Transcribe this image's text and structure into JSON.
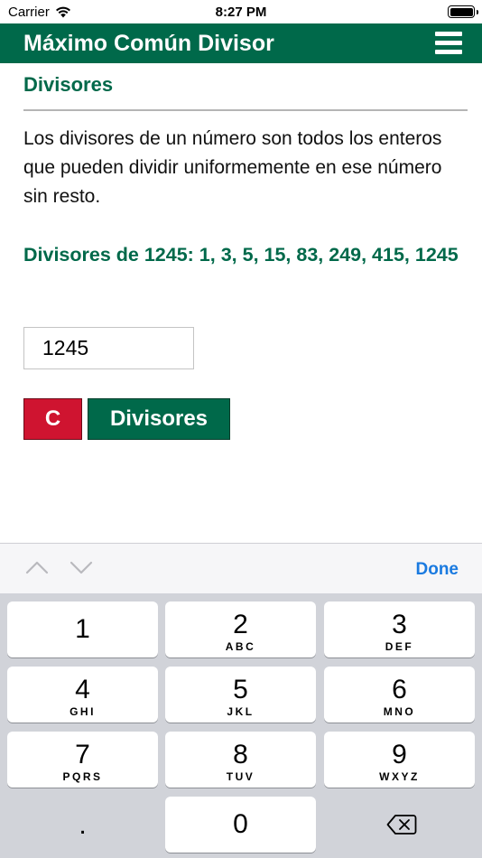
{
  "status_bar": {
    "carrier": "Carrier",
    "time": "8:27 PM",
    "battery_level": 1.0
  },
  "header": {
    "title": "Máximo Común Divisor",
    "menu_icon": "hamburger-menu-icon",
    "background": "#00694a"
  },
  "content": {
    "section_title": "Divisores",
    "description": "Los divisores de un número son todos los enteros que pueden dividir uniformemente en ese número sin resto.",
    "result": "Divisores de 1245: 1, 3, 5, 15, 83, 249, 415, 1245",
    "input_value": "1245",
    "clear_button": "C",
    "divisors_button": "Divisores",
    "accent_color": "#00694a",
    "clear_color": "#cf1430"
  },
  "keyboard_toolbar": {
    "prev_icon": "chevron-up-icon",
    "next_icon": "chevron-down-icon",
    "done_label": "Done",
    "done_color": "#1a7ae0"
  },
  "keyboard": {
    "keys": [
      {
        "num": "1",
        "letters": ""
      },
      {
        "num": "2",
        "letters": "ABC"
      },
      {
        "num": "3",
        "letters": "DEF"
      },
      {
        "num": "4",
        "letters": "GHI"
      },
      {
        "num": "5",
        "letters": "JKL"
      },
      {
        "num": "6",
        "letters": "MNO"
      },
      {
        "num": "7",
        "letters": "PQRS"
      },
      {
        "num": "8",
        "letters": "TUV"
      },
      {
        "num": "9",
        "letters": "WXYZ"
      }
    ],
    "decimal": ".",
    "zero": "0",
    "backspace_icon": "backspace-icon"
  }
}
